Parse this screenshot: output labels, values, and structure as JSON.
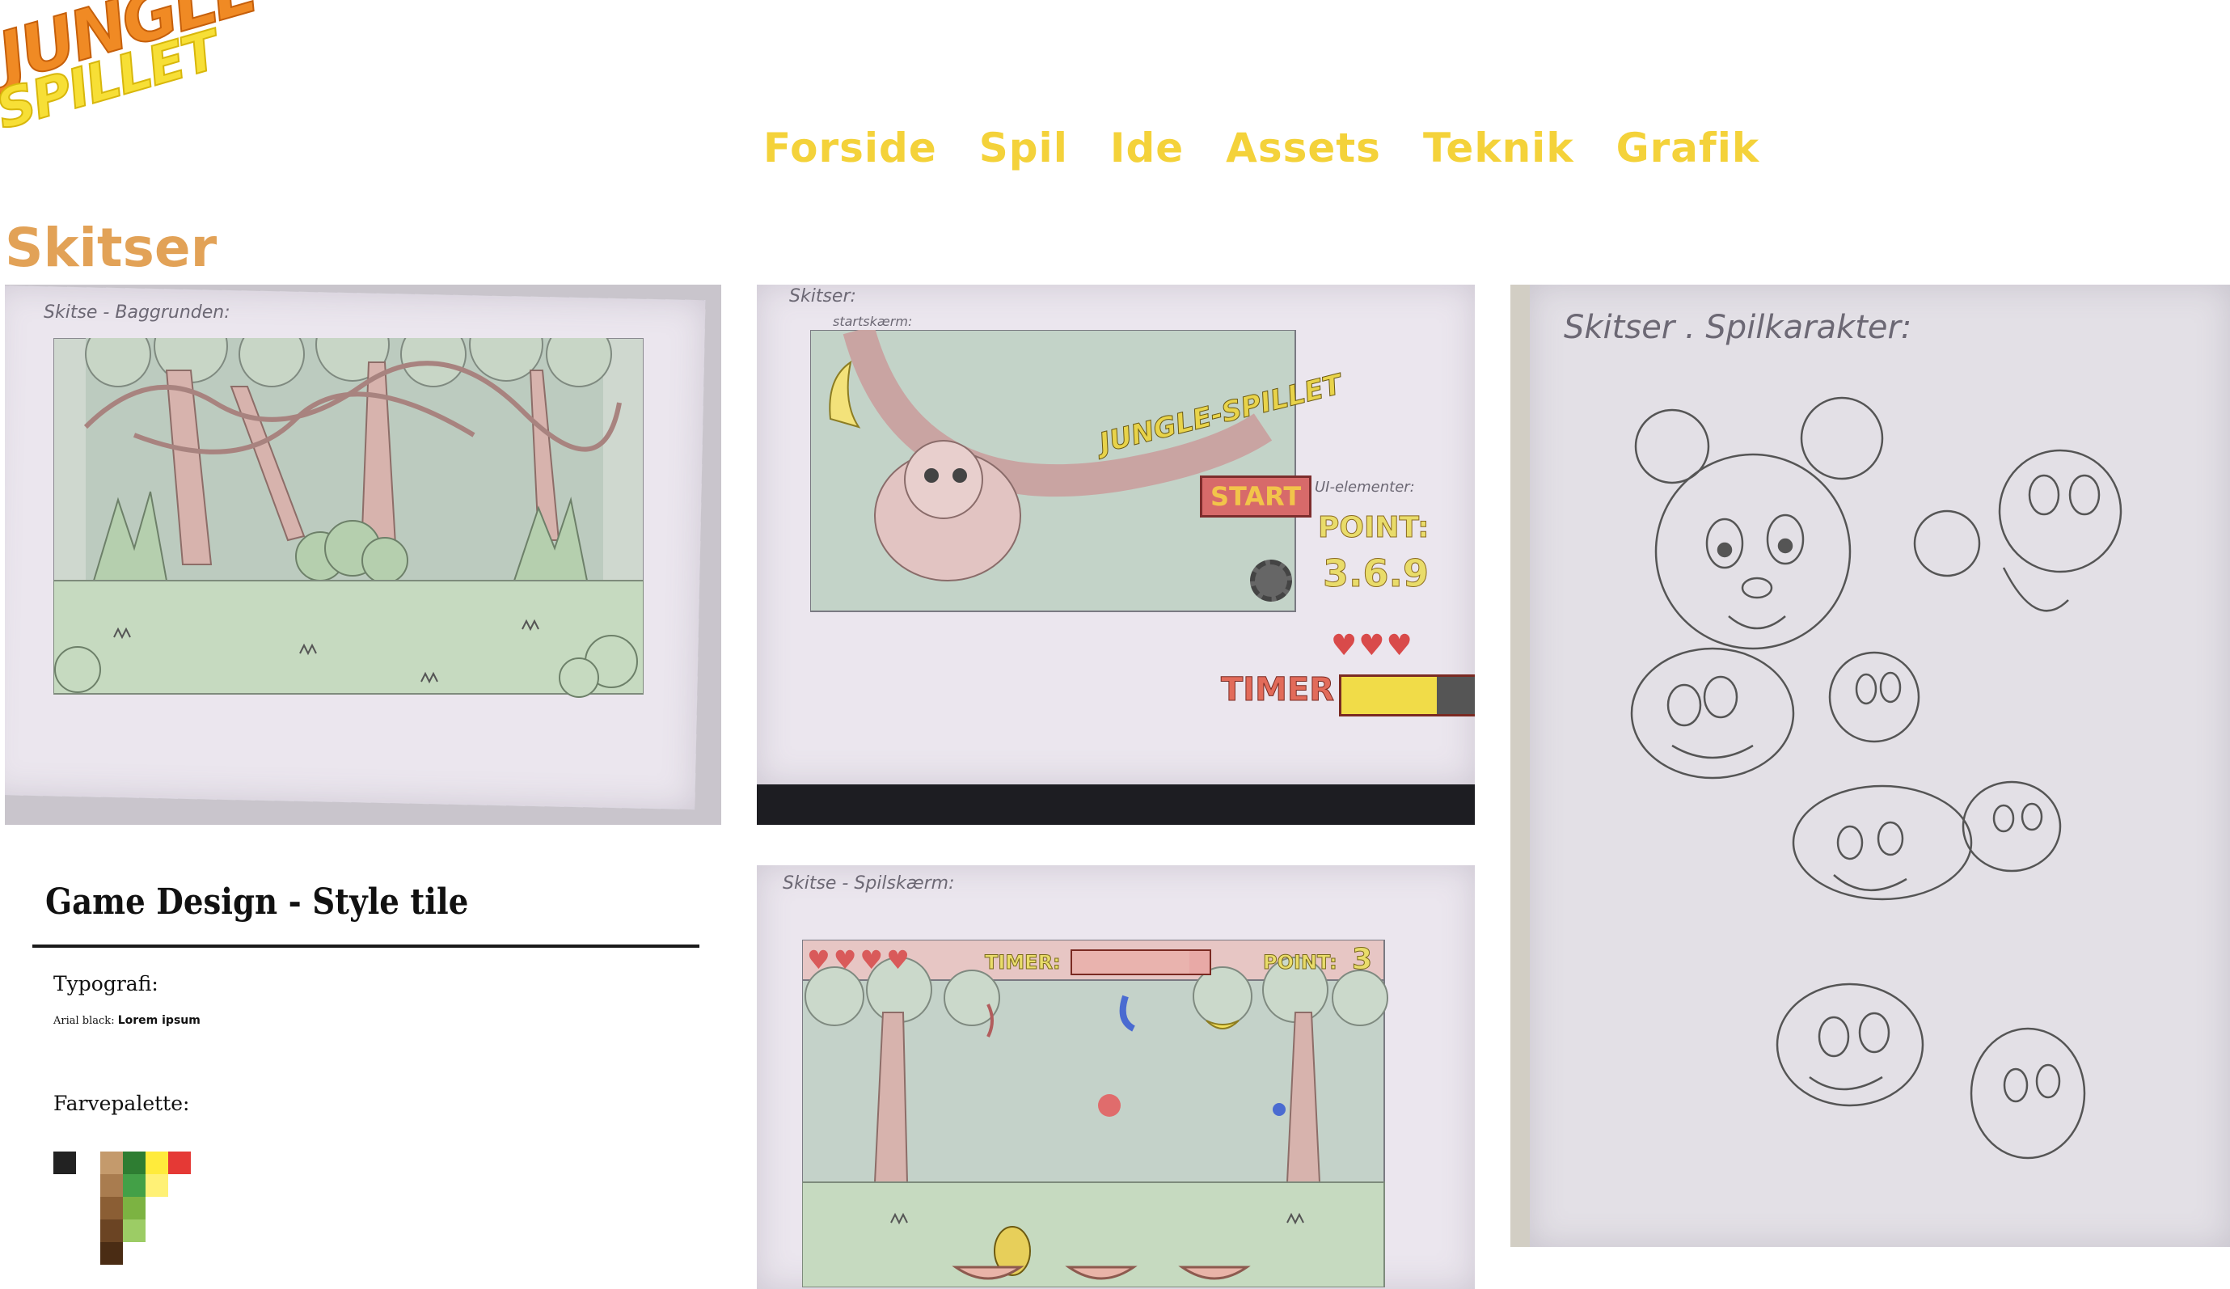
{
  "logo": {
    "line1": "JUNGLE",
    "line2": "SPILLET"
  },
  "nav": [
    {
      "label": "Forside"
    },
    {
      "label": "Spil"
    },
    {
      "label": "Ide"
    },
    {
      "label": "Assets"
    },
    {
      "label": "Teknik"
    },
    {
      "label": "Grafik"
    }
  ],
  "page": {
    "title": "Skitser"
  },
  "sketches": {
    "background": {
      "label": "Skitse - Baggrunden:"
    },
    "startscreen": {
      "label": "Skitser:",
      "sublabel": "startskærm:",
      "logo_text": "JUNGLE-SPILLET",
      "start_button": "START",
      "ui_label": "UI-elementer:",
      "point_label": "POINT:",
      "point_value": "3.6.9",
      "timer_label": "TIMER"
    },
    "gamescreen": {
      "label": "Skitse - Spilskærm:",
      "timer_label": "TIMER:",
      "point_label": "POINT:",
      "point_value": "3"
    },
    "character": {
      "label": "Skitser . Spilkarakter:"
    }
  },
  "style_tile": {
    "title": "Game Design - Style tile",
    "typography_label": "Typografi:",
    "typography_font": "Arial black:",
    "typography_sample": "Lorem ipsum",
    "palette_label": "Farvepalette:",
    "colors": {
      "black": "#222222",
      "tan": "#c49a6c",
      "brown_1": "#a97c4f",
      "brown_2": "#8b5e34",
      "brown_3": "#6b4423",
      "brown_4": "#4a2c14",
      "green_dark": "#2e7d32",
      "green_mid": "#43a047",
      "green_light": "#7cb342",
      "green_pale": "#9ccc65",
      "yellow": "#ffeb3b",
      "yellow_light": "#fff176",
      "red": "#e53935"
    }
  }
}
